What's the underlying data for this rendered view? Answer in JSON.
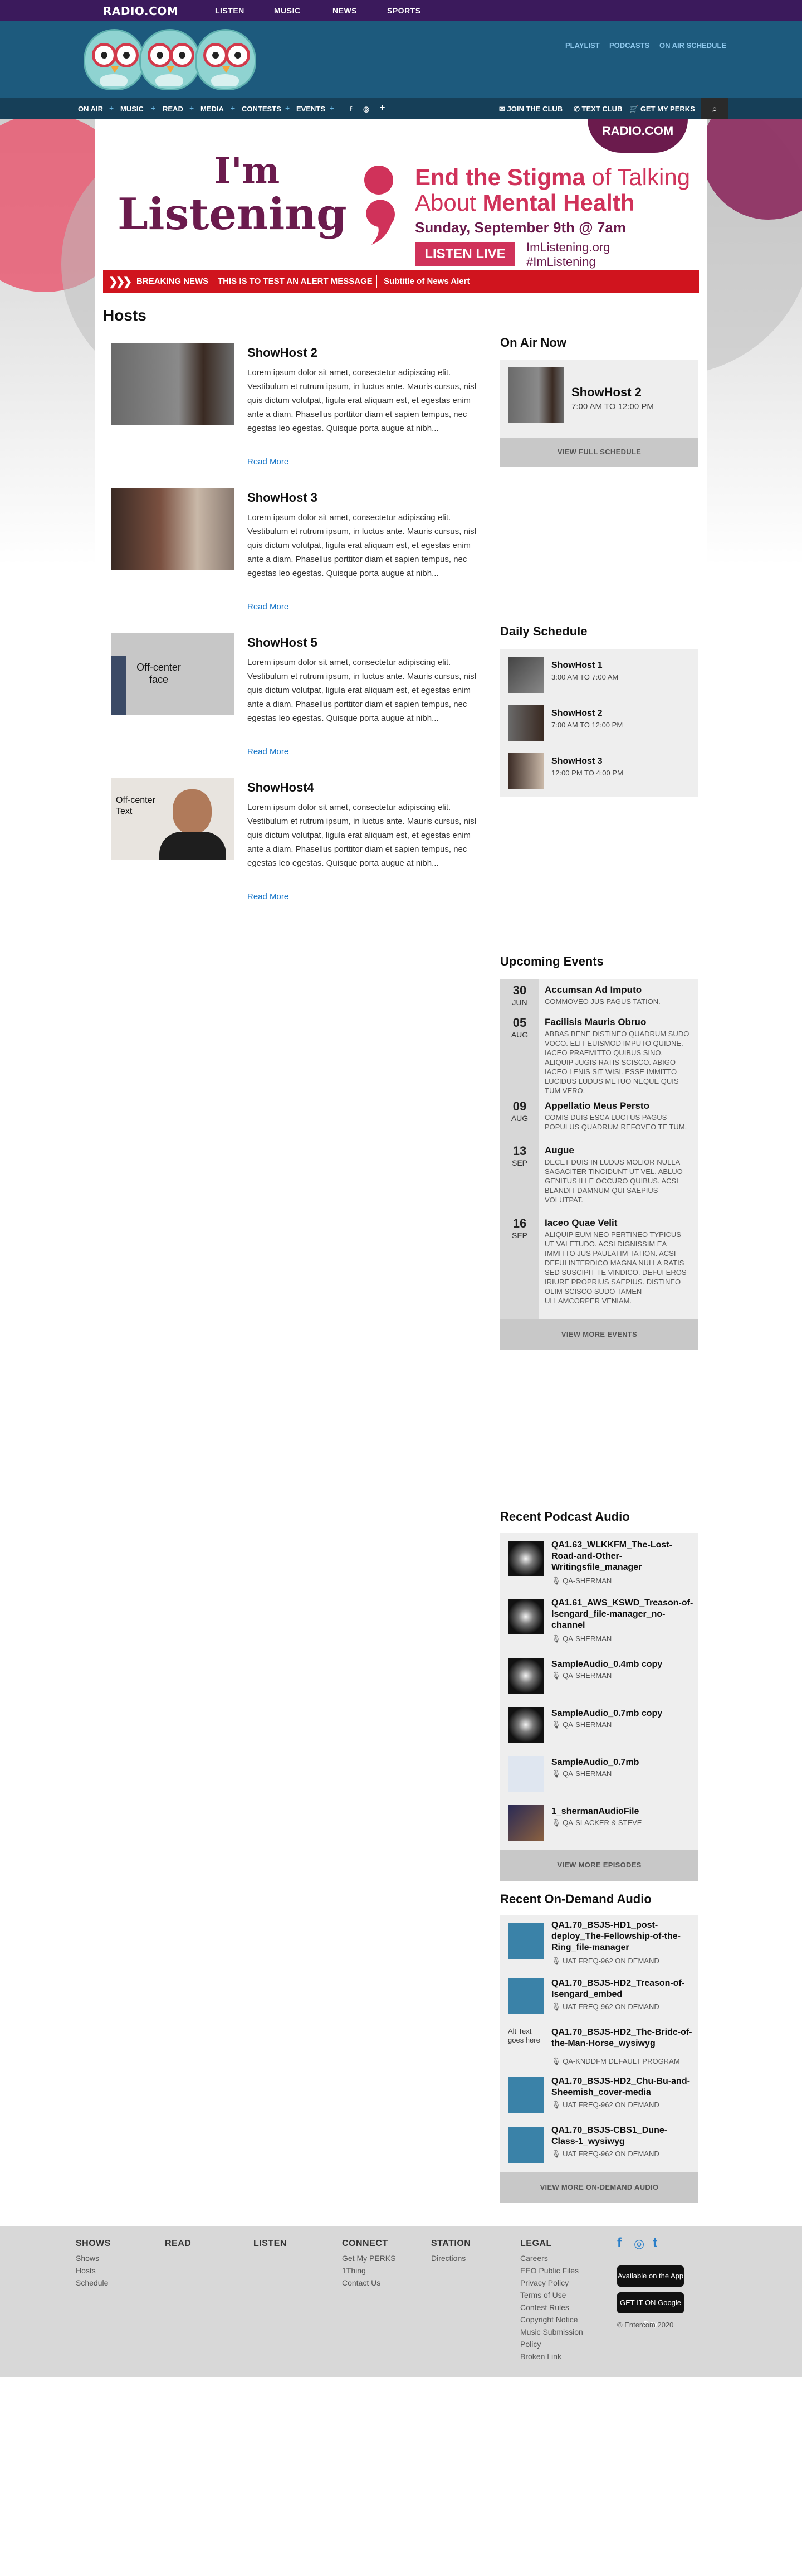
{
  "topbar": {
    "logo": "RADIO.COM",
    "links": [
      "LISTEN",
      "MUSIC",
      "NEWS",
      "SPORTS"
    ]
  },
  "hero": {
    "links": [
      "PLAYLIST",
      "PODCASTS",
      "ON AIR SCHEDULE"
    ]
  },
  "nav": {
    "items": [
      "ON AIR",
      "MUSIC",
      "READ",
      "MEDIA",
      "CONTESTS",
      "EVENTS"
    ],
    "social": [
      "f",
      "◎",
      "+"
    ],
    "right": [
      "JOIN THE CLUB",
      "TEXT CLUB",
      "GET MY PERKS"
    ],
    "search_icon": "search-icon"
  },
  "banner": {
    "badge": "RADIO.COM",
    "title_line1": "I'm",
    "title_line2": "Listening",
    "headline_a": "End the Stigma",
    "headline_b": " of Talking",
    "headline_c": "About ",
    "headline_d": "Mental Health",
    "date": "Sunday, September 9th @ 7am",
    "cta": "LISTEN LIVE",
    "url": "ImListening.org",
    "hashtag": "#ImListening",
    "colors": {
      "purple": "#6b1b4d",
      "pink": "#d0325a"
    }
  },
  "breaking": {
    "label": "BREAKING NEWS",
    "message": "THIS IS TO TEST AN ALERT MESSAGE",
    "subtitle": "Subtitle of News Alert"
  },
  "hosts": {
    "title": "Hosts",
    "read_more": "Read More",
    "items": [
      {
        "name": "ShowHost 2",
        "bio": "Lorem ipsum dolor sit amet, consectetur adipiscing elit. Vestibulum et rutrum ipsum, in luctus ante. Mauris cursus, nisl quis dictum volutpat, ligula erat aliquam est, et egestas enim ante a diam. Phasellus porttitor diam et sapien tempus, nec egestas leo egestas. Quisque porta augue at nibh..."
      },
      {
        "name": "ShowHost 3",
        "bio": "Lorem ipsum dolor sit amet, consectetur adipiscing elit. Vestibulum et rutrum ipsum, in luctus ante. Mauris cursus, nisl quis dictum volutpat, ligula erat aliquam est, et egestas enim ante a diam. Phasellus porttitor diam et sapien tempus, nec egestas leo egestas. Quisque porta augue at nibh..."
      },
      {
        "name": "ShowHost 5",
        "bio": "Lorem ipsum dolor sit amet, consectetur adipiscing elit. Vestibulum et rutrum ipsum, in luctus ante. Mauris cursus, nisl quis dictum volutpat, ligula erat aliquam est, et egestas enim ante a diam. Phasellus porttitor diam et sapien tempus, nec egestas leo egestas. Quisque porta augue at nibh...",
        "thumb_text": "Off-center face"
      },
      {
        "name": "ShowHost4",
        "bio": "Lorem ipsum dolor sit amet, consectetur adipiscing elit. Vestibulum et rutrum ipsum, in luctus ante. Mauris cursus, nisl quis dictum volutpat, ligula erat aliquam est, et egestas enim ante a diam. Phasellus porttitor diam et sapien tempus, nec egestas leo egestas. Quisque porta augue at nibh...",
        "thumb_text": "Off-center Text"
      }
    ]
  },
  "on_air": {
    "title": "On Air Now",
    "host": "ShowHost 2",
    "time": "7:00 AM TO 12:00 PM",
    "button": "VIEW FULL SCHEDULE"
  },
  "daily_schedule": {
    "title": "Daily Schedule",
    "items": [
      {
        "name": "ShowHost 1",
        "time": "3:00 AM TO 7:00 AM"
      },
      {
        "name": "ShowHost 2",
        "time": "7:00 AM TO 12:00 PM"
      },
      {
        "name": "ShowHost 3",
        "time": "12:00 PM TO 4:00 PM"
      }
    ]
  },
  "events": {
    "title": "Upcoming Events",
    "button": "VIEW MORE EVENTS",
    "items": [
      {
        "day": "30",
        "month": "JUN",
        "title": "Accumsan Ad Imputo",
        "desc": "COMMOVEO JUS PAGUS TATION."
      },
      {
        "day": "05",
        "month": "AUG",
        "title": "Facilisis Mauris Obruo",
        "desc": "ABBAS BENE DISTINEO QUADRUM SUDO VOCO. ELIT EUISMOD IMPUTO QUIDNE. IACEO PRAEMITTO QUIBUS SINO. ALIQUIP JUGIS RATIS SCISCO. ABIGO IACEO LENIS SIT WISI. ESSE IMMITTO LUCIDUS LUDUS METUO NEQUE QUIS TUM VERO."
      },
      {
        "day": "09",
        "month": "AUG",
        "title": "Appellatio Meus Persto",
        "desc": "COMIS DUIS ESCA LUCTUS PAGUS POPULUS QUADRUM REFOVEO TE TUM."
      },
      {
        "day": "13",
        "month": "SEP",
        "title": "Augue",
        "desc": "DECET DUIS IN LUDUS MOLIOR NULLA SAGACITER TINCIDUNT UT VEL. ABLUO GENITUS ILLE OCCURO QUIBUS. ACSI BLANDIT DAMNUM QUI SAEPIUS VOLUTPAT."
      },
      {
        "day": "16",
        "month": "SEP",
        "title": "Iaceo Quae Velit",
        "desc": "ALIQUIP EUM NEO PERTINEO TYPICUS UT VALETUDO. ACSI DIGNISSIM EA IMMITTO JUS PAULATIM TATION. ACSI DEFUI INTERDICO MAGNA NULLA RATIS SED SUSCIPIT TE VINDICO. DEFUI EROS IRIURE PROPRIUS SAEPIUS. DISTINEO OLIM SCISCO SUDO TAMEN ULLAMCORPER VENIAM."
      }
    ]
  },
  "podcasts": {
    "title": "Recent Podcast Audio",
    "button": "VIEW MORE EPISODES",
    "items": [
      {
        "title": "QA1.63_WLKKFM_The-Lost-Road-and-Other-Writingsfile_manager",
        "author": "QA-SHERMAN"
      },
      {
        "title": "QA1.61_AWS_KSWD_Treason-of-Isengard_file-manager_no-channel",
        "author": "QA-SHERMAN"
      },
      {
        "title": "SampleAudio_0.4mb copy",
        "author": "QA-SHERMAN"
      },
      {
        "title": "SampleAudio_0.7mb copy",
        "author": "QA-SHERMAN"
      },
      {
        "title": "SampleAudio_0.7mb",
        "author": "QA-SHERMAN"
      },
      {
        "title": "1_shermanAudioFile",
        "author": "QA-SLACKER & STEVE"
      }
    ]
  },
  "on_demand": {
    "title": "Recent On-Demand Audio",
    "button": "VIEW MORE ON-DEMAND AUDIO",
    "items": [
      {
        "title": "QA1.70_BSJS-HD1_post-deploy_The-Fellowship-of-the-Ring_file-manager",
        "author": "UAT FREQ-962 ON DEMAND"
      },
      {
        "title": "QA1.70_BSJS-HD2_Treason-of-Isengard_embed",
        "author": "UAT FREQ-962 ON DEMAND"
      },
      {
        "title": "QA1.70_BSJS-HD2_The-Bride-of-the-Man-Horse_wysiwyg",
        "author": "QA-KNDDFM DEFAULT PROGRAM",
        "thumb_alt": "Alt Text goes here"
      },
      {
        "title": "QA1.70_BSJS-HD2_Chu-Bu-and-Sheemish_cover-media",
        "author": "UAT FREQ-962 ON DEMAND"
      },
      {
        "title": "QA1.70_BSJS-CBS1_Dune-Class-1_wysiwyg",
        "author": "UAT FREQ-962 ON DEMAND"
      }
    ]
  },
  "footer": {
    "cols": [
      {
        "head": "SHOWS",
        "links": [
          "Shows",
          "Hosts",
          "Schedule"
        ]
      },
      {
        "head": "READ",
        "links": []
      },
      {
        "head": "LISTEN",
        "links": []
      },
      {
        "head": "CONNECT",
        "links": [
          "Get My PERKS",
          "1Thing",
          "Contact Us"
        ]
      },
      {
        "head": "STATION",
        "links": [
          "Directions"
        ]
      },
      {
        "head": "LEGAL",
        "links": [
          "Careers",
          "EEO Public Files",
          "Privacy Policy",
          "Terms of Use",
          "Contest Rules",
          "Copyright Notice",
          "Music Submission Policy",
          "Broken Link"
        ]
      }
    ],
    "social": [
      "f",
      "◎",
      "t"
    ],
    "app_store": "Available on the App Store",
    "google_play": "GET IT ON Google Play",
    "copyright": "© Entercom 2020"
  }
}
